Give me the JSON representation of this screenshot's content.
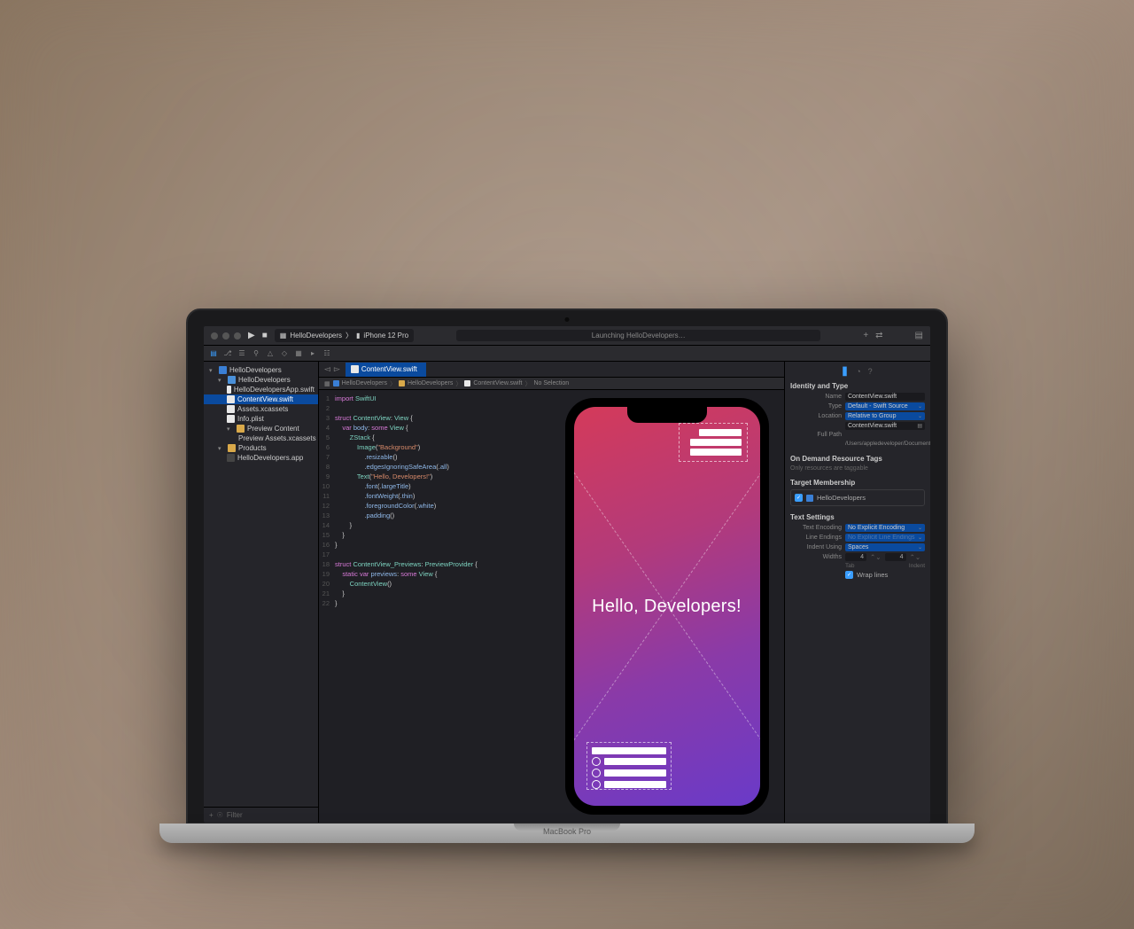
{
  "laptop_label": "MacBook Pro",
  "toolbar": {
    "scheme_app": "HelloDevelopers",
    "scheme_device": "iPhone 12 Pro",
    "status": "Launching HelloDevelopers…"
  },
  "navigator": {
    "project": "HelloDevelopers",
    "group": "HelloDevelopers",
    "items": {
      "app_swift": "HelloDevelopersApp.swift",
      "content_swift": "ContentView.swift",
      "assets": "Assets.xcassets",
      "info": "Info.plist",
      "preview_group": "Preview Content",
      "preview_assets": "Preview Assets.xcassets",
      "products_group": "Products",
      "product_app": "HelloDevelopers.app"
    },
    "filter_placeholder": "Filter"
  },
  "tab": {
    "active": "ContentView.swift"
  },
  "jump": {
    "a": "HelloDevelopers",
    "b": "HelloDevelopers",
    "c": "ContentView.swift",
    "d": "No Selection"
  },
  "code": [
    {
      "n": "1",
      "t": "import SwiftUI",
      "cls": ""
    },
    {
      "n": "2",
      "t": "",
      "cls": ""
    },
    {
      "n": "3",
      "t": "struct ContentView: View {",
      "cls": ""
    },
    {
      "n": "4",
      "t": "    var body: some View {",
      "cls": ""
    },
    {
      "n": "5",
      "t": "        ZStack {",
      "cls": ""
    },
    {
      "n": "6",
      "t": "            Image(\"Background\")",
      "cls": ""
    },
    {
      "n": "7",
      "t": "                .resizable()",
      "cls": ""
    },
    {
      "n": "8",
      "t": "                .edgesIgnoringSafeArea(.all)",
      "cls": ""
    },
    {
      "n": "9",
      "t": "            Text(\"Hello, Developers!\")",
      "cls": ""
    },
    {
      "n": "10",
      "t": "                .font(.largeTitle)",
      "cls": ""
    },
    {
      "n": "11",
      "t": "                .fontWeight(.thin)",
      "cls": ""
    },
    {
      "n": "12",
      "t": "                .foregroundColor(.white)",
      "cls": ""
    },
    {
      "n": "13",
      "t": "                .padding()",
      "cls": ""
    },
    {
      "n": "14",
      "t": "        }",
      "cls": ""
    },
    {
      "n": "15",
      "t": "    }",
      "cls": ""
    },
    {
      "n": "16",
      "t": "}",
      "cls": ""
    },
    {
      "n": "17",
      "t": "",
      "cls": ""
    },
    {
      "n": "18",
      "t": "struct ContentView_Previews: PreviewProvider {",
      "cls": ""
    },
    {
      "n": "19",
      "t": "    static var previews: some View {",
      "cls": ""
    },
    {
      "n": "20",
      "t": "        ContentView()",
      "cls": ""
    },
    {
      "n": "21",
      "t": "    }",
      "cls": ""
    },
    {
      "n": "22",
      "t": "}",
      "cls": ""
    }
  ],
  "preview": {
    "hello": "Hello, Developers!"
  },
  "inspector": {
    "identity_title": "Identity and Type",
    "name_label": "Name",
    "name_val": "ContentView.swift",
    "type_label": "Type",
    "type_val": "Default - Swift Source",
    "location_label": "Location",
    "location_val": "Relative to Group",
    "file_val": "ContentView.swift",
    "fullpath_label": "Full Path",
    "fullpath_val": "/Users/appledeveloper/Documents/HelloDevelopers/HelloDevelopers/ContentView.swift",
    "odr_title": "On Demand Resource Tags",
    "odr_hint": "Only resources are taggable",
    "membership_title": "Target Membership",
    "membership_target": "HelloDevelopers",
    "text_title": "Text Settings",
    "enc_label": "Text Encoding",
    "enc_val": "No Explicit Encoding",
    "le_label": "Line Endings",
    "le_val": "No Explicit Line Endings",
    "indent_label": "Indent Using",
    "indent_val": "Spaces",
    "widths_label": "Widths",
    "tab_val": "4",
    "indent_num": "4",
    "tab_sub": "Tab",
    "indent_sub": "Indent",
    "wrap_label": "Wrap lines"
  }
}
